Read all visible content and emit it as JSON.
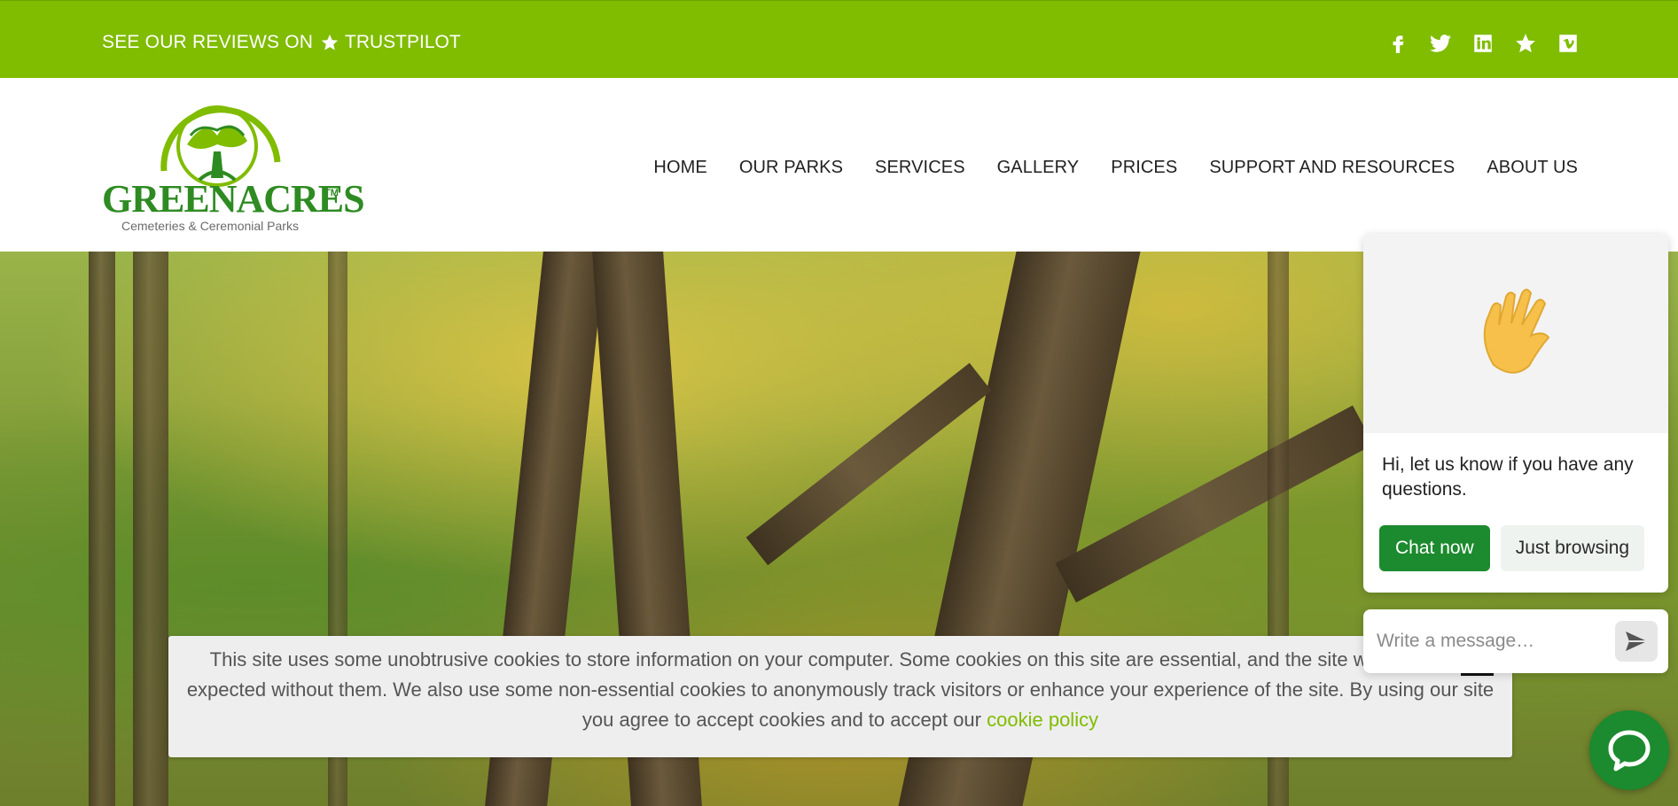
{
  "topbar": {
    "reviews_text": "SEE OUR REVIEWS ON",
    "trustpilot_label": "TRUSTPILOT",
    "social_icons": [
      "facebook-icon",
      "twitter-icon",
      "linkedin-icon",
      "star-icon",
      "vimeo-icon"
    ],
    "background_color": "#80bc00"
  },
  "header": {
    "logo_wordmark": "GREENACRES",
    "logo_tm": "TM",
    "logo_tagline": "Cemeteries & Ceremonial Parks",
    "nav": [
      "HOME",
      "OUR PARKS",
      "SERVICES",
      "GALLERY",
      "PRICES",
      "SUPPORT AND RESOURCES",
      "ABOUT US"
    ]
  },
  "cookie_banner": {
    "text": "This site uses some unobtrusive cookies to store information on your computer. Some cookies on this site are essential, and the site won't work as expected without them. We also use some non-essential cookies to anonymously track visitors or enhance your experience of the site. By using our site you agree to accept cookies and to accept our",
    "link_text": "cookie policy",
    "link_color": "#80bc00"
  },
  "chat": {
    "greeting": "Hi, let us know if you have any questions.",
    "chat_now": "Chat now",
    "just_browsing": "Just browsing",
    "input_placeholder": "Write a message…",
    "accent_color": "#1c8a2e"
  }
}
